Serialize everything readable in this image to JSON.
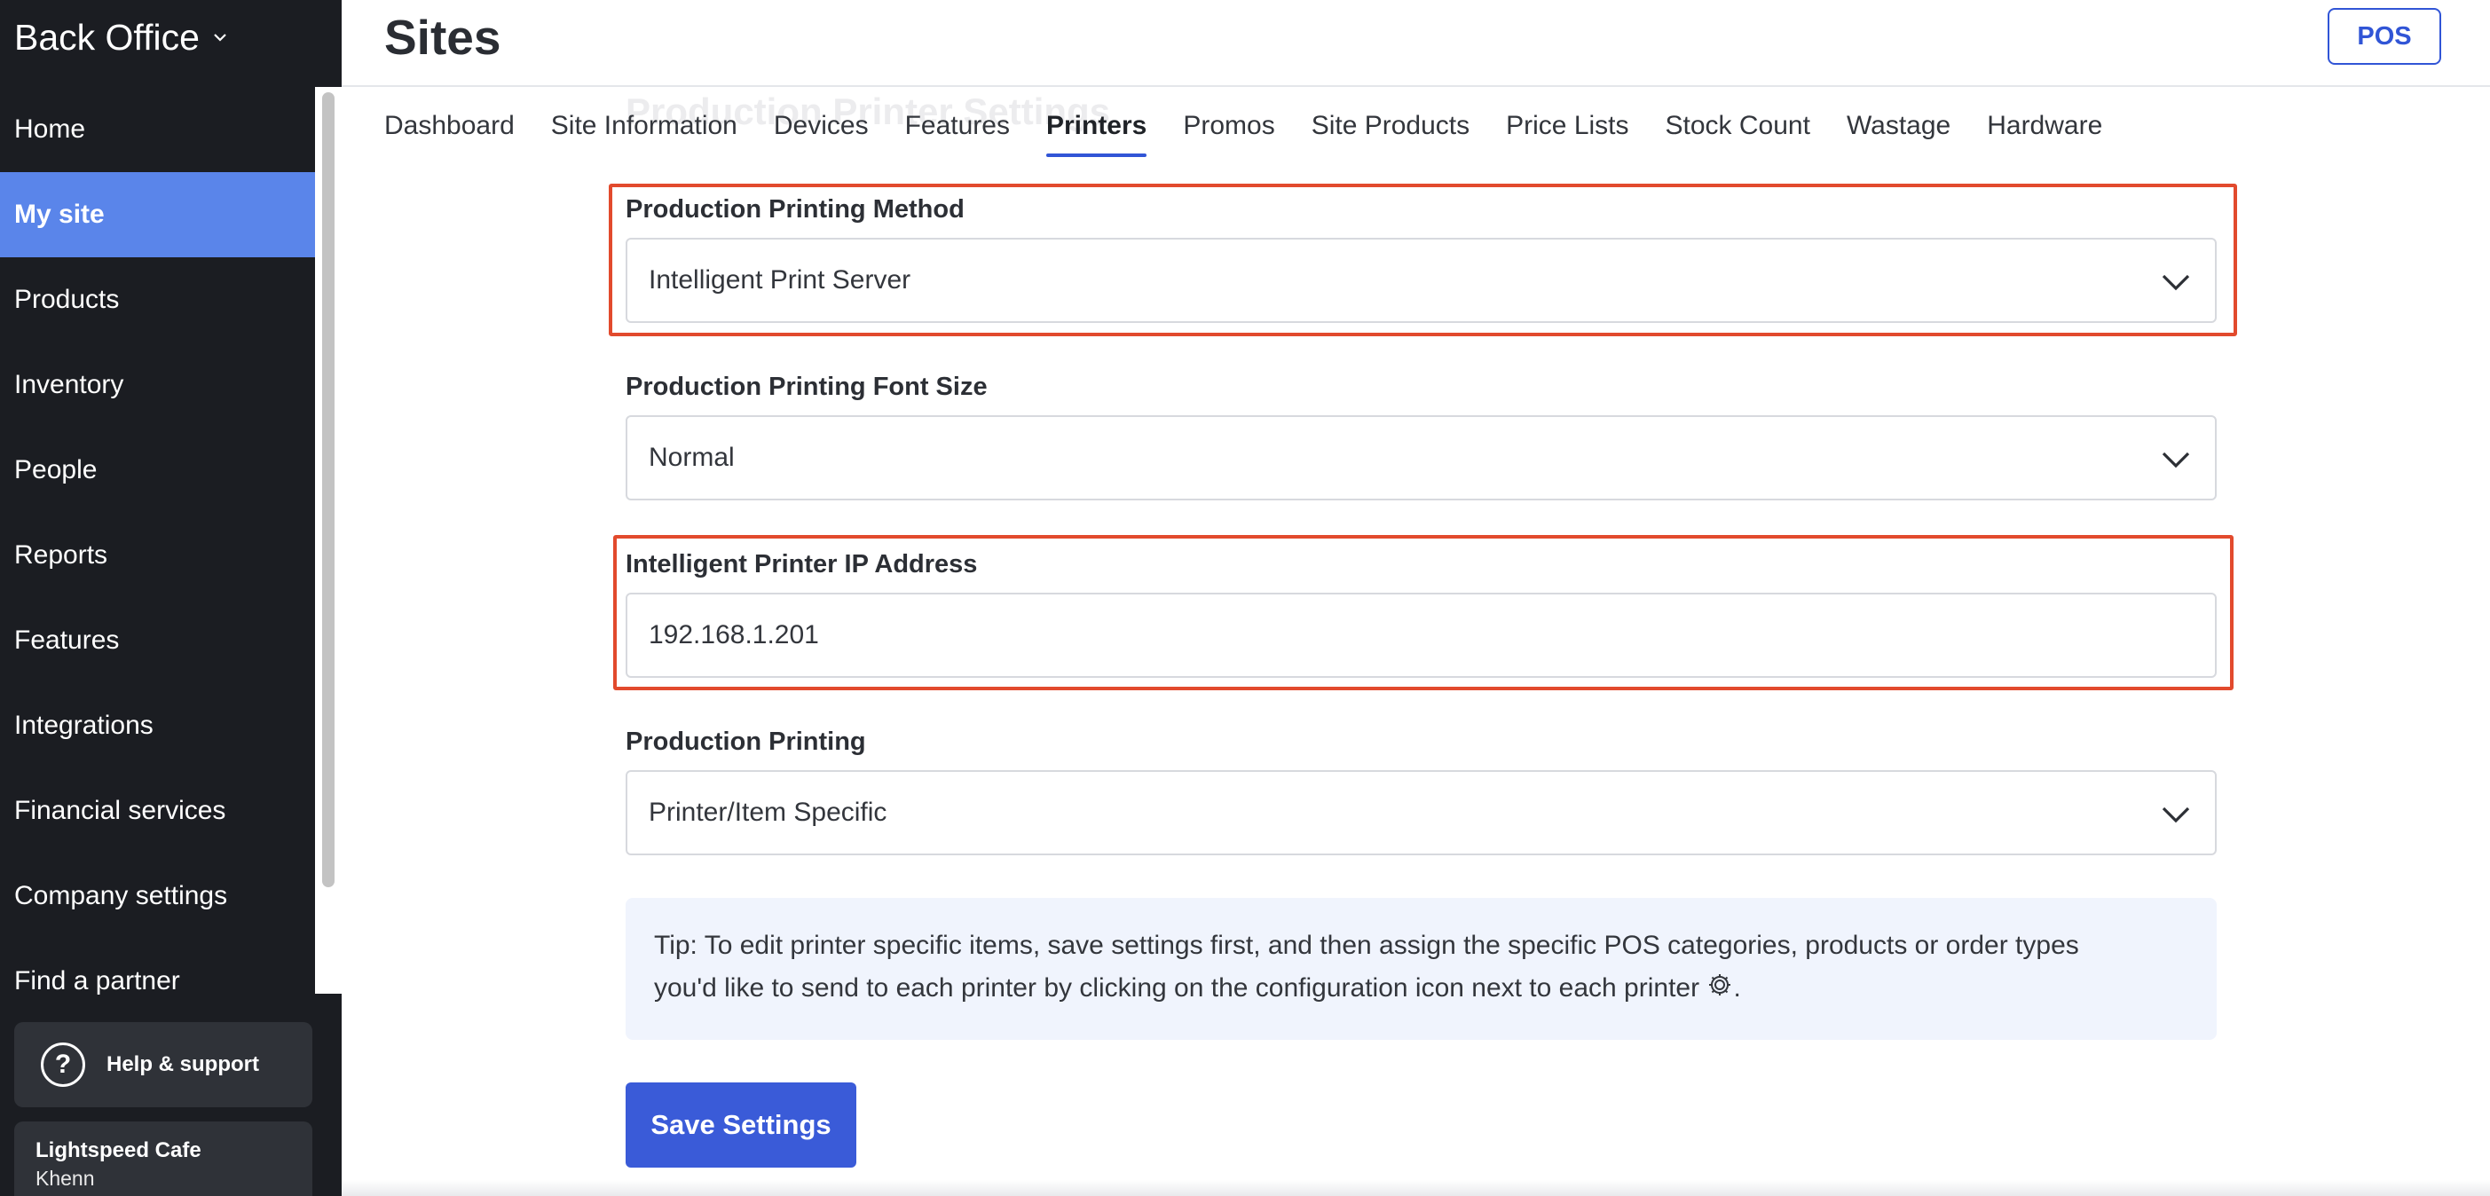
{
  "sidebar": {
    "brand": "Back Office",
    "items": [
      {
        "label": "Home"
      },
      {
        "label": "My site",
        "active": true
      },
      {
        "label": "Products"
      },
      {
        "label": "Inventory"
      },
      {
        "label": "People"
      },
      {
        "label": "Reports"
      },
      {
        "label": "Features"
      },
      {
        "label": "Integrations"
      },
      {
        "label": "Financial services"
      },
      {
        "label": "Company settings"
      },
      {
        "label": "Find a partner"
      }
    ],
    "help_label": "Help & support",
    "account": {
      "name": "Lightspeed Cafe",
      "user": "Khenn"
    }
  },
  "header": {
    "title": "Sites",
    "pos_label": "POS"
  },
  "section_heading": "Production Printer Settings",
  "tabs": [
    {
      "label": "Dashboard"
    },
    {
      "label": "Site Information"
    },
    {
      "label": "Devices"
    },
    {
      "label": "Features"
    },
    {
      "label": "Printers",
      "active": true
    },
    {
      "label": "Promos"
    },
    {
      "label": "Site Products"
    },
    {
      "label": "Price Lists"
    },
    {
      "label": "Stock Count"
    },
    {
      "label": "Wastage"
    },
    {
      "label": "Hardware"
    }
  ],
  "form": {
    "printing_method": {
      "label": "Production Printing Method",
      "value": "Intelligent Print Server"
    },
    "font_size": {
      "label": "Production Printing Font Size",
      "value": "Normal"
    },
    "ip_address": {
      "label": "Intelligent Printer IP Address",
      "value": "192.168.1.201"
    },
    "production_printing": {
      "label": "Production Printing",
      "value": "Printer/Item Specific"
    }
  },
  "tip": {
    "line1": "Tip: To edit printer specific items, save settings first, and then assign the specific POS categories, products or order types",
    "line2": "you'd like to send to each printer by clicking on the configuration icon next to each printer",
    "end": "."
  },
  "save_label": "Save Settings",
  "colors": {
    "sidebar_bg": "#1b1d22",
    "active_nav": "#5a85ea",
    "accent": "#3155d6",
    "highlight_box": "#e24a2d",
    "tip_bg": "#f0f4fd"
  },
  "icons": {
    "brand_chevron": "chevron-down-icon",
    "select_caret": "chevron-down-icon",
    "help": "question-circle-icon",
    "config": "gear-icon"
  }
}
